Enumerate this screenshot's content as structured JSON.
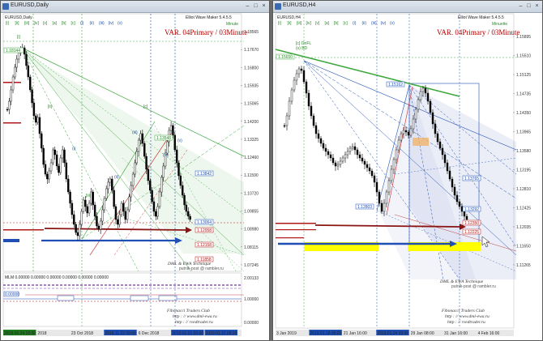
{
  "left": {
    "title": "EURUSD,Daily",
    "chart_title": "EURUSD,Daily",
    "indicator_name": "Elliot Wave Maker 5.4.5.5",
    "degree_name": "Minute",
    "variant_label": "VAR. 04Primary / 03Minute",
    "wave_labels": [
      "[i]",
      "[ii]",
      "[iii]",
      "[iv]",
      "[v]",
      "[a]",
      "[b]",
      "[c]",
      "(i)",
      "(ii)",
      "(iii)",
      "(iv)",
      "(v)"
    ],
    "wave_labels_header": [
      "[i]",
      "[ii]",
      "[iii]",
      "[iv]",
      "[v]",
      "[a]",
      "[b]",
      "[c]",
      "(i)",
      "(ii)",
      "(iii)",
      "(iv)",
      "(v)"
    ],
    "y_ticks": [
      "1.18565",
      "1.17670",
      "1.16800",
      "1.15935",
      "1.15065",
      "1.14200",
      "1.13325",
      "1.12460",
      "1.11590",
      "1.10720",
      "1.09855",
      "1.08980",
      "1.08115",
      "1.07245"
    ],
    "indicator_header": "MLM  0.00000  0.00000  0.00000  0.00000  0.00000  0.00000",
    "indicator_y": [
      "2.00133",
      "1.00000",
      "0.00000"
    ],
    "price_boxes": [
      "1.18144",
      "1.13842",
      "1.13064",
      "1.12958",
      "1.12158",
      "1.13548",
      "1.11858"
    ],
    "zero_label": "0.00000",
    "watermark": "DML & EWA Technique",
    "watermark_sub": "putnik-post @ rambler.ru",
    "footer_1": "Fibonacci    Traders    Club",
    "footer_2": "http : // www.dml-ewa.ru",
    "footer_3": "http : // rvedtrader.ru",
    "x_ticks": [
      "2018.09.24 18:00",
      "2018",
      "23 Oct 2018",
      "2018.11.22 09:00",
      "6 Dec 2018",
      "2019.01.01 00:00",
      "2019.01.31 09:29"
    ]
  },
  "right": {
    "title": "EURUSD,H4",
    "chart_title": "EURUSD,H4",
    "indicator_name": "Elliot Wave Maker 5.4.5.5",
    "degree_name": "Minuette",
    "variant_label": "VAR. 04Primary / 03Minute",
    "wave_labels_header": [
      "[i]",
      "[ii]",
      "[iii]",
      "[iv]",
      "[v]",
      "[a]",
      "[b]",
      "[c]",
      "(i)",
      "(ii)",
      "(iii)",
      "(iv)",
      "(v)"
    ],
    "wave_labels": [
      "[c] OnFL",
      "(v) BD"
    ],
    "y_ticks": [
      "1.15895",
      "1.15510",
      "1.15125",
      "1.14735",
      "1.14350",
      "1.13965",
      "1.13580",
      "1.13195",
      "1.12810",
      "1.12425",
      "1.12035",
      "1.11650",
      "1.11265"
    ],
    "price_boxes": [
      "1.15650",
      "1.15162",
      "1.13765",
      "1.13292",
      "1.12803",
      "1.12350",
      "1.12225"
    ],
    "watermark": "DML & EWA Technique",
    "watermark_sub": "putnik-post @ rambler.ru",
    "footer_1": "Fibonacci    Traders    Club",
    "footer_2": "http : // www.dml-ewa.ru",
    "footer_3": "http : // rvedtrader.ru",
    "x_ticks": [
      "3 Jan 2019",
      "2019.01.18 05:00",
      "21 Jan 16:00",
      "2019.01.24 09:00",
      "29 Jan 08:00",
      "31 Jan 16:00",
      "4 Feb 16:00"
    ]
  },
  "colors": {
    "up_trend": "#3ea83e",
    "down_trend": "#1f4fb5",
    "resistance": "#b01818",
    "highlight": "#ffff00",
    "candles": "#000000"
  }
}
